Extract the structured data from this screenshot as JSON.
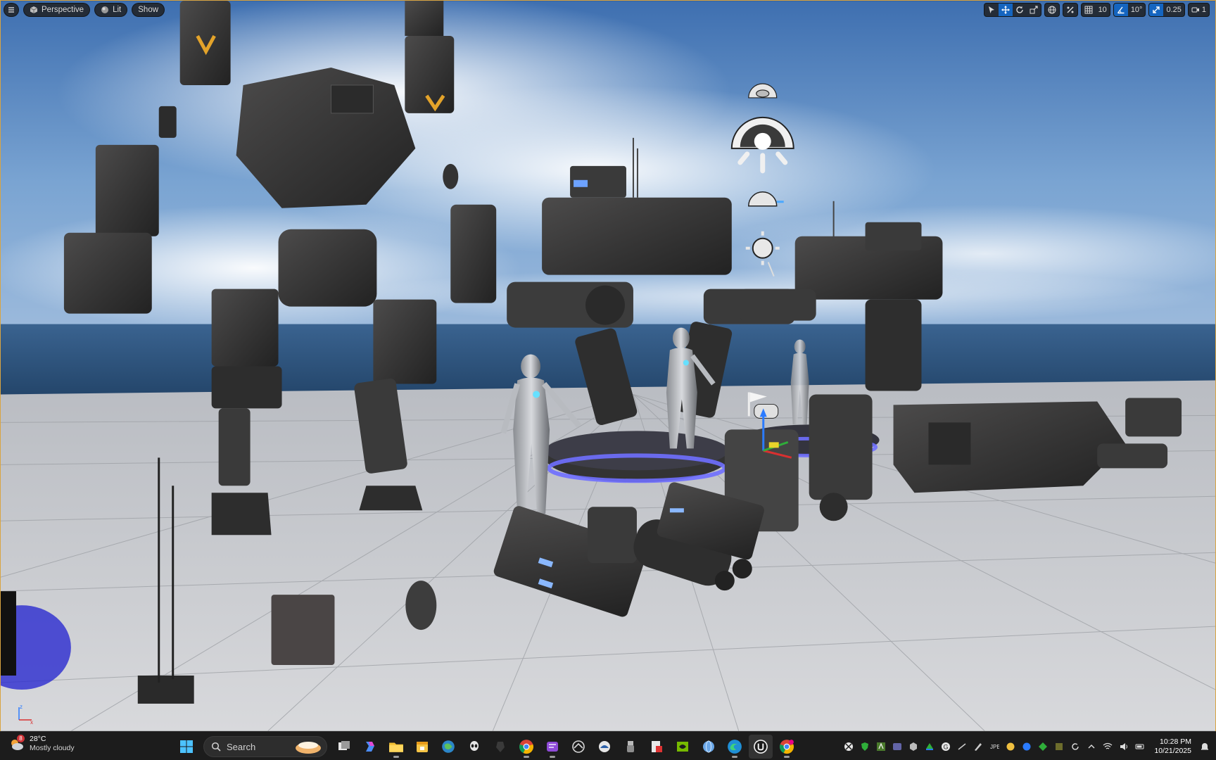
{
  "viewport": {
    "menu_icon": "hamburger-menu-icon",
    "perspective_label": "Perspective",
    "lit_label": "Lit",
    "show_label": "Show",
    "grid_snap_value": "10",
    "rotation_snap_value": "10°",
    "scale_snap_value": "0.25",
    "camera_speed_value": "1"
  },
  "taskbar": {
    "weather": {
      "temperature": "28°C",
      "condition": "Mostly cloudy",
      "badge": "8"
    },
    "search_label": "Search",
    "apps": [
      "windows-start-icon",
      "task-view-icon",
      "copilot-icon",
      "file-explorer-icon",
      "calendar-icon",
      "browser-globe-icon",
      "alien-app-icon",
      "dark-app-icon",
      "chrome-icon",
      "purple-app-icon",
      "steam-like-icon",
      "cloud-app-icon",
      "usb-drive-icon",
      "file-tool-icon",
      "nvidia-icon",
      "globe-app-icon",
      "edge-icon",
      "unreal-engine-icon",
      "chrome-profile-icon"
    ],
    "clock": {
      "time": "10:28 PM",
      "date": "10/21/2025"
    }
  },
  "colors": {
    "accent_blue": "#1565c0",
    "viewport_border": "#d9a441",
    "taskbar_bg": "#1c1c1c"
  }
}
